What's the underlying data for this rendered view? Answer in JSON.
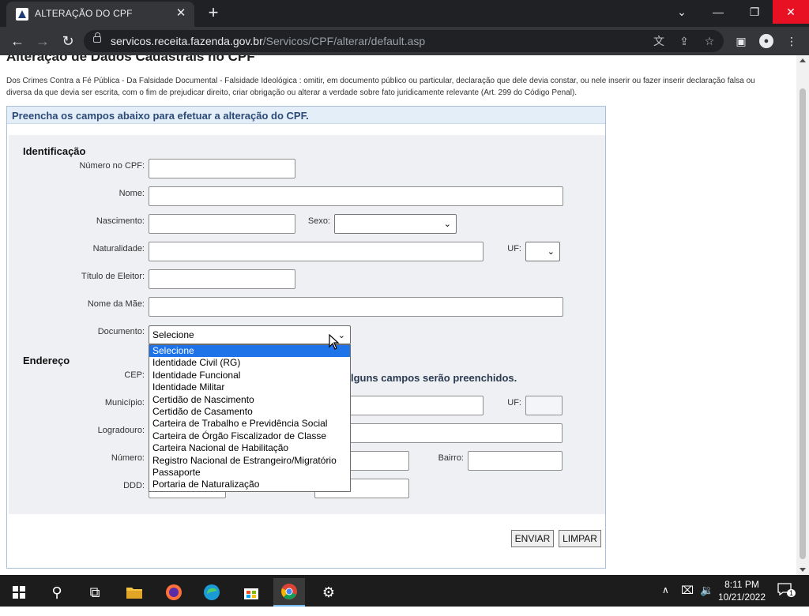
{
  "browser": {
    "tab_title": "ALTERAÇÃO DO CPF",
    "tab_close": "✕",
    "new_tab": "+",
    "url_host": "servicos.receita.fazenda.gov.br",
    "url_path": "/Servicos/CPF/alterar/default.asp",
    "window_controls": {
      "minimize": "—",
      "maximize": "❐",
      "close": "✕",
      "tab_search": "⌄"
    }
  },
  "page": {
    "heading": "Alteração de Dados Cadastrais no CPF",
    "legal_text": "Dos Crimes Contra a Fé Pública - Da Falsidade Documental - Falsidade Ideológica : omitir, em documento público ou particular, declaração que dele devia constar, ou nele inserir ou fazer inserir declaração falsa ou diversa da que devia ser escrita, com o fim de prejudicar direito, criar obrigação ou alterar a verdade sobre fato juridicamente relevante (Art. 299 do Código Penal).",
    "form_header": "Preencha os campos abaixo para efetuar a alteração do CPF."
  },
  "identificacao": {
    "title": "Identificação",
    "cpf_label": "Número no CPF:",
    "nome_label": "Nome:",
    "nascimento_label": "Nascimento:",
    "sexo_label": "Sexo:",
    "naturalidade_label": "Naturalidade:",
    "uf_label": "UF:",
    "titulo_label": "Título de Eleitor:",
    "mae_label": "Nome da Mãe:",
    "documento_label": "Documento:",
    "documento_value": "Selecione"
  },
  "documento_options": [
    "Selecione",
    "Identidade Civil (RG)",
    "Identidade Funcional",
    "Identidade Militar",
    "Certidão de Nascimento",
    "Certidão de Casamento",
    "Carteira de Trabalho e Previdência Social",
    "Carteira de Órgão Fiscalizador de Classe",
    "Carteira Nacional de Habilitação",
    "Registro Nacional de Estrangeiro/Migratório",
    "Passaporte",
    "Portaria de Naturalização"
  ],
  "endereco": {
    "title": "Endereço",
    "cep_label": "CEP:",
    "cep_note_visible": "lguns campos serão preenchidos.",
    "municipio_label": "Município:",
    "uf_label": "UF:",
    "logradouro_label": "Logradouro:",
    "numero_label": "Número:",
    "bairro_label": "Bairro:",
    "ddd_label": "DDD:"
  },
  "buttons": {
    "enviar": "ENVIAR",
    "limpar": "LIMPAR"
  },
  "taskbar": {
    "time": "8:11 PM",
    "date": "10/21/2022",
    "notification_count": "1"
  }
}
